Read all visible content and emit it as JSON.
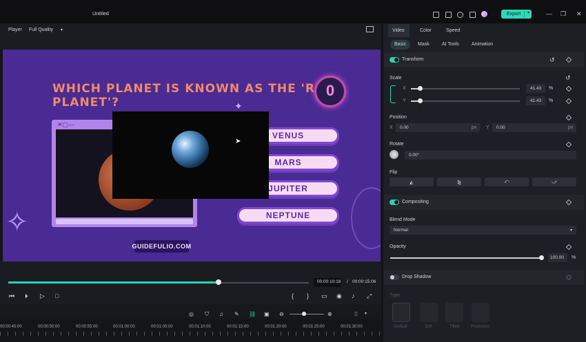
{
  "window": {
    "title": "Untitled",
    "export_label": "Export"
  },
  "player": {
    "label": "Player",
    "quality": "Full Quality",
    "quiz_title": "WHICH PLANET IS KNOWN AS THE 'RED PLANET'?",
    "timer_value": "0",
    "options": [
      "VENUS",
      "MARS",
      "JUPITER",
      "NEPTUNE"
    ],
    "watermark": "GUIDEFULIO.COM",
    "current_time": "00:00:10:18",
    "separator": "/",
    "total_time": "00:00:15:06",
    "progress_fraction": 0.7
  },
  "panel": {
    "tabs": [
      "Video",
      "Color",
      "Speed"
    ],
    "subtabs": [
      "Basic",
      "Mask",
      "AI Tools",
      "Animation"
    ],
    "transform_label": "Transform",
    "scale": {
      "label": "Scale",
      "x_label": "X",
      "y_label": "Y",
      "x_value": "41.43",
      "y_value": "41.43",
      "unit": "%",
      "fraction": 0.08
    },
    "position": {
      "label": "Position",
      "x_label": "X",
      "x_value": "0.00",
      "y_label": "Y",
      "y_value": "0.00",
      "unit": "px"
    },
    "rotate": {
      "label": "Rotate",
      "value": "0.00°"
    },
    "flip": {
      "label": "Flip"
    },
    "compositing_label": "Compositing",
    "blend": {
      "label": "Blend Mode",
      "value": "Normal"
    },
    "opacity": {
      "label": "Opacity",
      "value": "100.00",
      "unit": "%",
      "fraction": 1.0
    },
    "drop_shadow_label": "Drop Shadow",
    "type_label": "Type",
    "shadow_types": [
      "Default",
      "Soft",
      "Tilted",
      "Projection"
    ]
  },
  "timeline": {
    "ticks": [
      "00:00:45:00",
      "00:00:50:00",
      "00:00:55:00",
      "00:01:00:00",
      "00:01:05:00",
      "00:01:10:00",
      "00:01:15:00",
      "00:01:20:00",
      "00:01:25:00",
      "00:01:30:00"
    ]
  }
}
